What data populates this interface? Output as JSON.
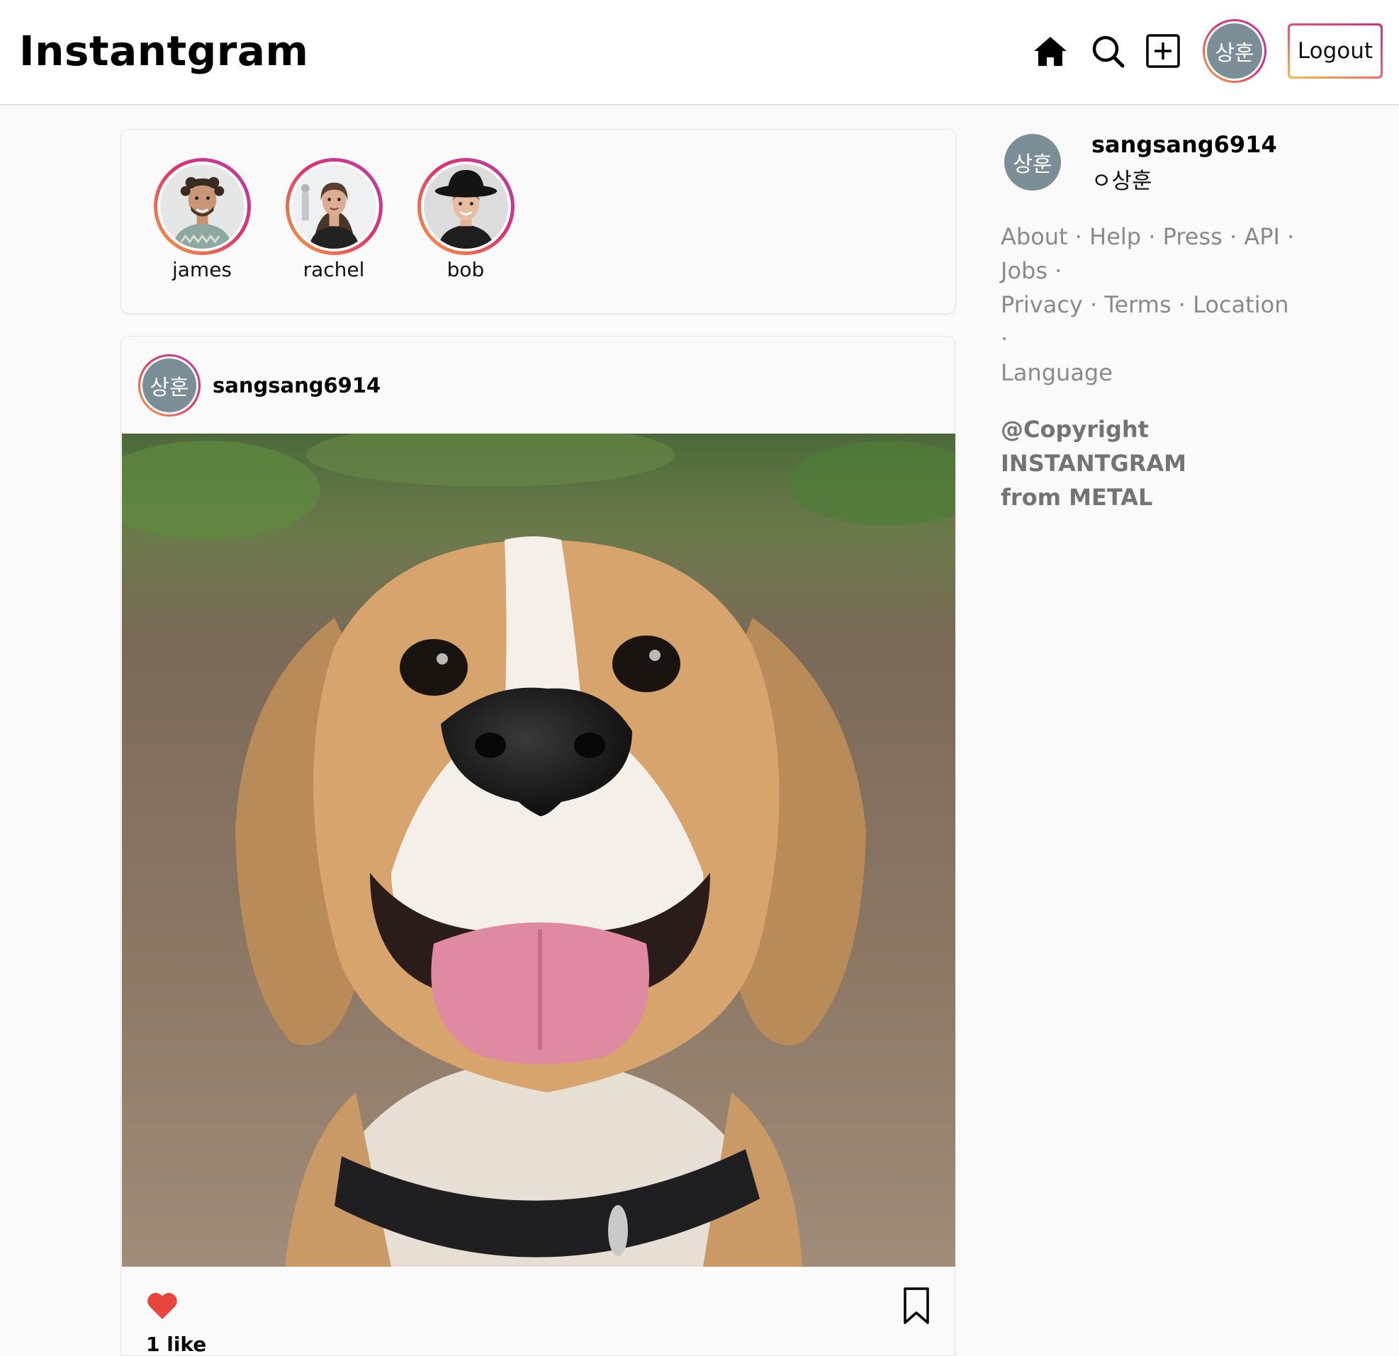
{
  "header": {
    "logo": "Instantgram",
    "avatar_text": "상훈",
    "logout_label": "Logout"
  },
  "stories": [
    {
      "name": "james"
    },
    {
      "name": "rachel"
    },
    {
      "name": "bob"
    }
  ],
  "post": {
    "avatar_text": "상훈",
    "username": "sangsang6914",
    "likes_text": "1 like"
  },
  "sidebar": {
    "avatar_text": "상훈",
    "username": "sangsang6914",
    "name": "ㅇ상훈",
    "links": [
      "About",
      "Help",
      "Press",
      "API",
      "Jobs",
      "Privacy",
      "Terms",
      "Location",
      "Language"
    ],
    "separator": "·",
    "copyright": [
      "@Copyright",
      "INSTANTGRAM",
      "from METAL"
    ]
  },
  "colors": {
    "avatar_bg": "#7b8e98",
    "ring_gradient": [
      "#f6a13a",
      "#e1306c",
      "#b23fb5"
    ],
    "like_red": "#e8453c",
    "footer_text": "#8a8a8a"
  }
}
